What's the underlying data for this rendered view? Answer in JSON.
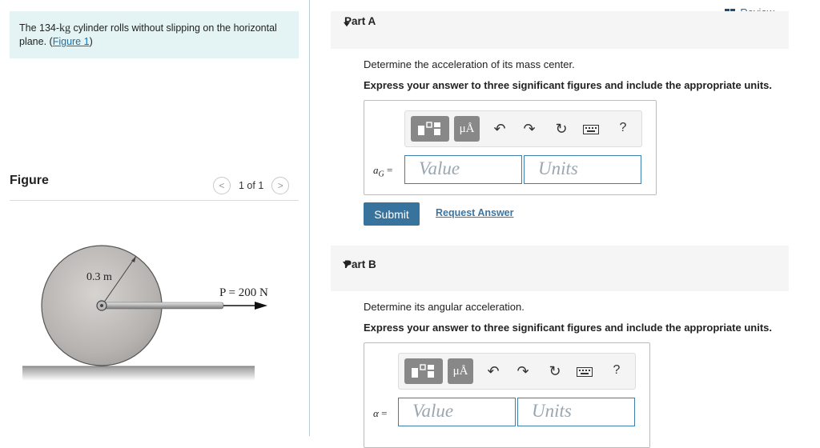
{
  "problem": {
    "text_before": "The 134-",
    "unit": "kg",
    "text_after": " cylinder rolls without slipping on the horizontal plane. (",
    "link": "Figure 1",
    "close": ")"
  },
  "figure": {
    "heading": "Figure",
    "pager": "1 of 1",
    "prev_icon": "<",
    "next_icon": ">",
    "radius_label": "0.3 m",
    "force_label": "P = 200 N"
  },
  "review_link": "Review",
  "part_a": {
    "title": "Part A",
    "question": "Determine the acceleration of its mass center.",
    "instruction": "Express your answer to three significant figures and include the appropriate units.",
    "var_label": "a",
    "var_sub": "G",
    "equals": "=",
    "value_placeholder": "Value",
    "units_placeholder": "Units",
    "submit": "Submit",
    "request": "Request Answer"
  },
  "part_b": {
    "title": "Part B",
    "question": "Determine its angular acceleration.",
    "instruction": "Express your answer to three significant figures and include the appropriate units.",
    "var_label": "α",
    "equals": "=",
    "value_placeholder": "Value",
    "units_placeholder": "Units"
  },
  "toolbar": {
    "units_label": "μÅ",
    "help": "?",
    "icons": [
      "templates-icon",
      "units-icon",
      "undo-icon",
      "redo-icon",
      "reset-icon",
      "keyboard-icon",
      "help-icon"
    ]
  },
  "colors": {
    "accent": "#38739d",
    "field_border": "#3c7fb1",
    "panel": "#e4f4f4"
  }
}
